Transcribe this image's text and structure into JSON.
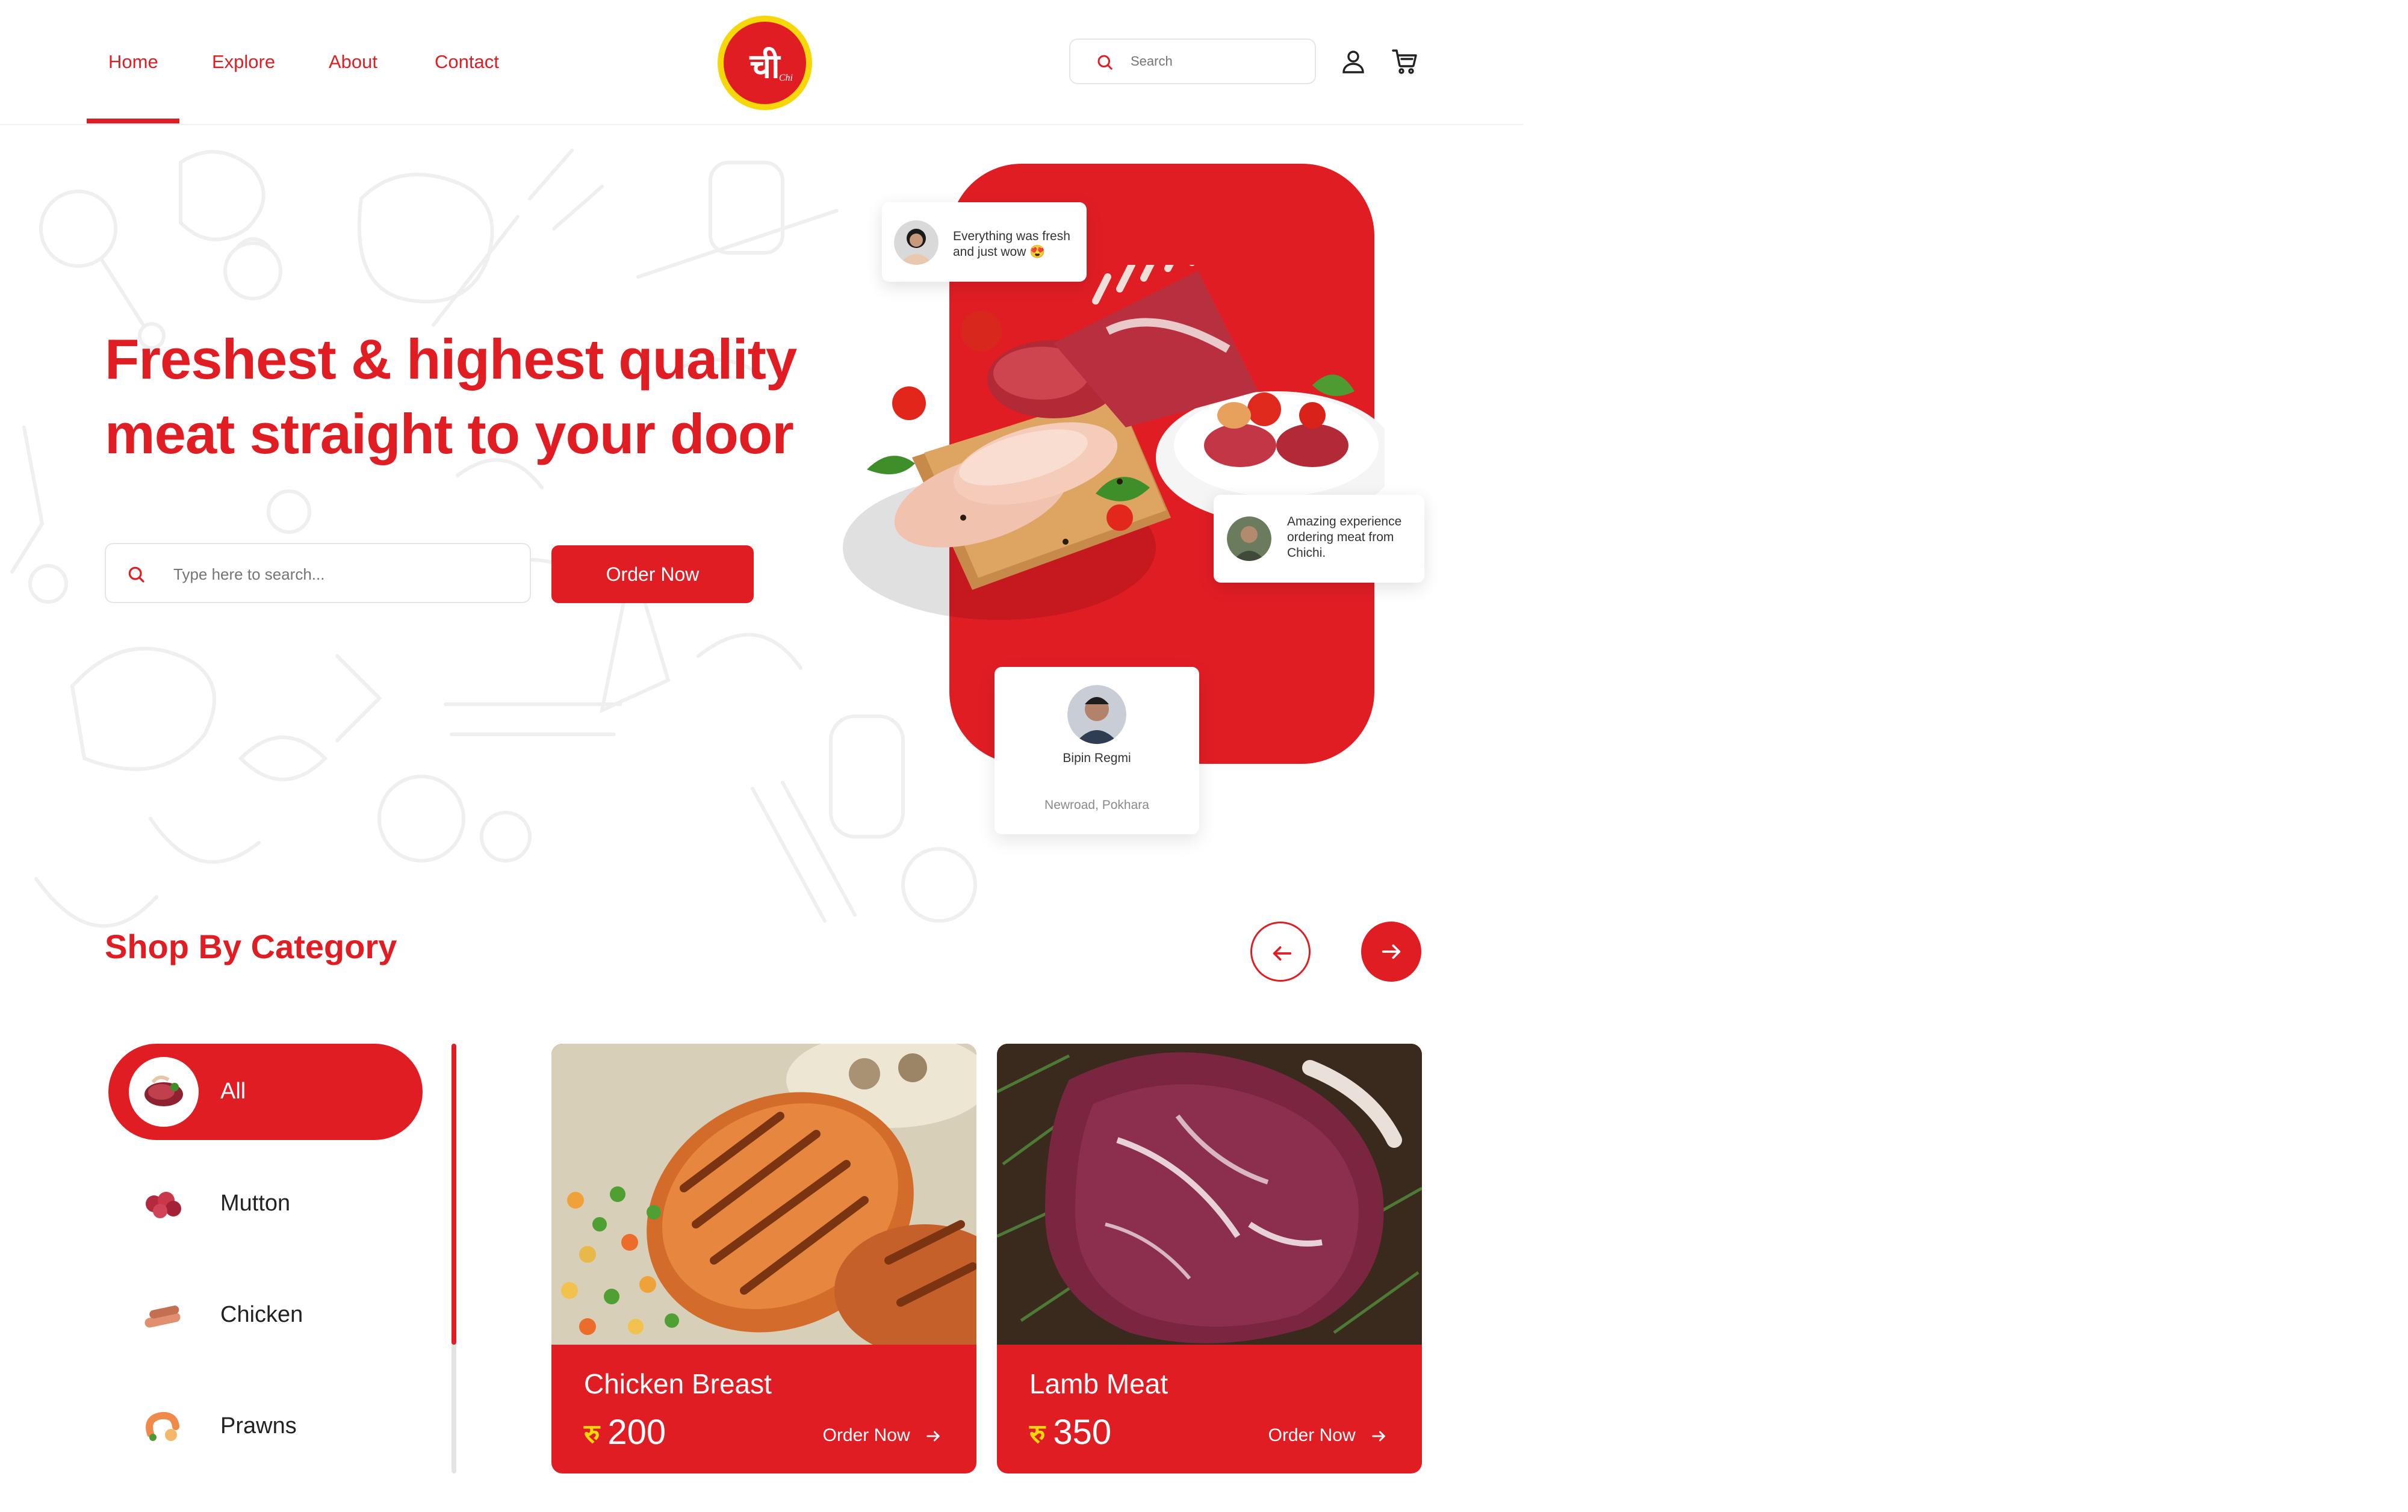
{
  "brand": {
    "logo_text": "ची",
    "logo_sub": "Chi",
    "colors": {
      "primary": "#E11D24",
      "accent": "#F6D70A"
    }
  },
  "nav": {
    "items": [
      {
        "label": "Home",
        "active": true
      },
      {
        "label": "Explore",
        "active": false
      },
      {
        "label": "About",
        "active": false
      },
      {
        "label": "Contact",
        "active": false
      }
    ]
  },
  "header": {
    "search_placeholder": "Search",
    "icons": [
      "search-icon",
      "user-icon",
      "cart-icon"
    ]
  },
  "hero": {
    "title_line1": "Freshest & highest quality",
    "title_line2": "meat straight to your door",
    "search_placeholder": "Type here to search...",
    "order_button": "Order Now"
  },
  "reviews": [
    {
      "text_line1": "Everything was fresh",
      "text_line2": "and just wow 😍"
    },
    {
      "text_line1": "Amazing experience",
      "text_line2": "ordering meat from",
      "text_line3": "Chichi."
    }
  ],
  "profile": {
    "name": "Bipin Regmi",
    "location": "Newroad, Pokhara"
  },
  "category_section": {
    "title": "Shop By Category",
    "categories": [
      {
        "label": "All",
        "active": true
      },
      {
        "label": "Mutton",
        "active": false
      },
      {
        "label": "Chicken",
        "active": false
      },
      {
        "label": "Prawns",
        "active": false
      }
    ],
    "scroll_progress": 0.7
  },
  "products": [
    {
      "name": "Chicken Breast",
      "currency": "रु",
      "price": "200",
      "order_label": "Order Now"
    },
    {
      "name": "Lamb Meat",
      "currency": "रु",
      "price": "350",
      "order_label": "Order Now"
    }
  ]
}
